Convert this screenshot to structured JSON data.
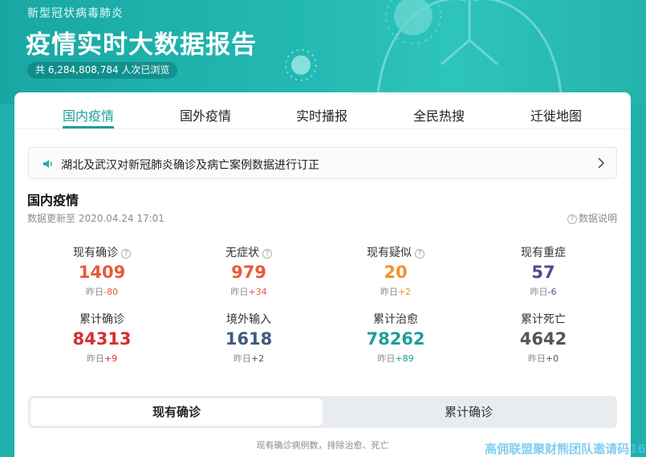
{
  "hero": {
    "subtitle": "新型冠状病毒肺炎",
    "title": "疫情实时大数据报告",
    "views": "共 6,284,808,784 人次已浏览"
  },
  "tabs": [
    {
      "label": "国内疫情",
      "active": true
    },
    {
      "label": "国外疫情"
    },
    {
      "label": "实时播报"
    },
    {
      "label": "全民热搜"
    },
    {
      "label": "迁徙地图"
    }
  ],
  "notice": {
    "text": "湖北及武汉对新冠肺炎确诊及病亡案例数据进行订正",
    "icon": "speaker-icon"
  },
  "section": {
    "title": "国内疫情",
    "updated": "数据更新至 2020.04.24 17:01",
    "data_note": "数据说明"
  },
  "stats": [
    {
      "label": "现有确诊",
      "value": "1409",
      "delta_prefix": "昨日",
      "delta": "-80",
      "color": "#e85a3c",
      "delta_color": "#e85a3c",
      "help": true
    },
    {
      "label": "无症状",
      "value": "979",
      "delta_prefix": "昨日",
      "delta": "+34",
      "color": "#e85a3c",
      "delta_color": "#e85a3c",
      "help": true
    },
    {
      "label": "现有疑似",
      "value": "20",
      "delta_prefix": "昨日",
      "delta": "+2",
      "color": "#f0932b",
      "delta_color": "#f0932b",
      "help": true
    },
    {
      "label": "现有重症",
      "value": "57",
      "delta_prefix": "昨日",
      "delta": "-6",
      "color": "#4f4b8f",
      "delta_color": "#4f4b8f",
      "help": false
    },
    {
      "label": "累计确诊",
      "value": "84313",
      "delta_prefix": "昨日",
      "delta": "+9",
      "color": "#d82f2f",
      "delta_color": "#d82f2f",
      "help": false
    },
    {
      "label": "境外输入",
      "value": "1618",
      "delta_prefix": "昨日",
      "delta": "+2",
      "color": "#3f5b7e",
      "delta_color": "#3f5b7e",
      "help": false
    },
    {
      "label": "累计治愈",
      "value": "78262",
      "delta_prefix": "昨日",
      "delta": "+89",
      "color": "#1f9e9a",
      "delta_color": "#1f9e9a",
      "help": false
    },
    {
      "label": "累计死亡",
      "value": "4642",
      "delta_prefix": "昨日",
      "delta": "+0",
      "color": "#555555",
      "delta_color": "#555555",
      "help": false
    }
  ],
  "segment": {
    "options": [
      "现有确诊",
      "累计确诊"
    ],
    "selected": "现有确诊"
  },
  "footnote": "现有确诊病例数，排除治愈、死亡",
  "watermark": "高佣联盟聚财熊团队邀请码16"
}
